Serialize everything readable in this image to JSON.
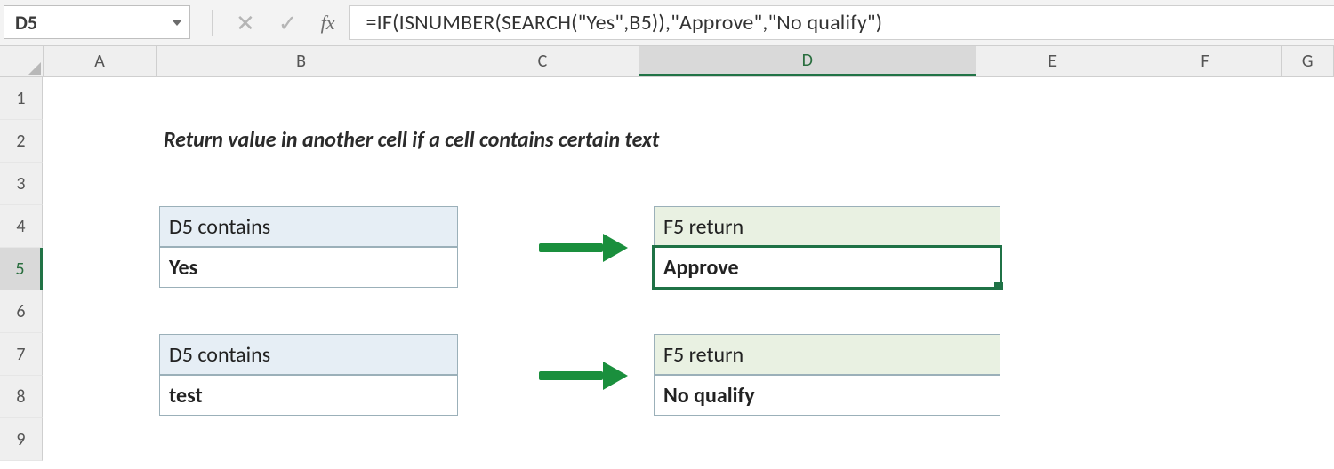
{
  "namebox": {
    "value": "D5"
  },
  "fx": {
    "label": "fx"
  },
  "formula": {
    "value": "=IF(ISNUMBER(SEARCH(\"Yes\",B5)),\"Approve\",\"No qualify\")"
  },
  "columns": [
    "A",
    "B",
    "C",
    "D",
    "E",
    "F",
    "G"
  ],
  "rows": [
    "1",
    "2",
    "3",
    "4",
    "5",
    "6",
    "7",
    "8",
    "9"
  ],
  "selected": {
    "col": "D",
    "row": "5"
  },
  "title": "Return value in another cell if a cell contains certain text",
  "blocks": {
    "top": {
      "left_header": "D5 contains",
      "left_value": "Yes",
      "right_header": "F5 return",
      "right_value": "Approve"
    },
    "bottom": {
      "left_header": "D5 contains",
      "left_value": "test",
      "right_header": "F5 return",
      "right_value": "No qualify"
    }
  },
  "colors": {
    "excel_green": "#217346",
    "arrow_green": "#1a8f3d",
    "header_blue": "#e6eef5",
    "header_green": "#e9f1e2"
  }
}
